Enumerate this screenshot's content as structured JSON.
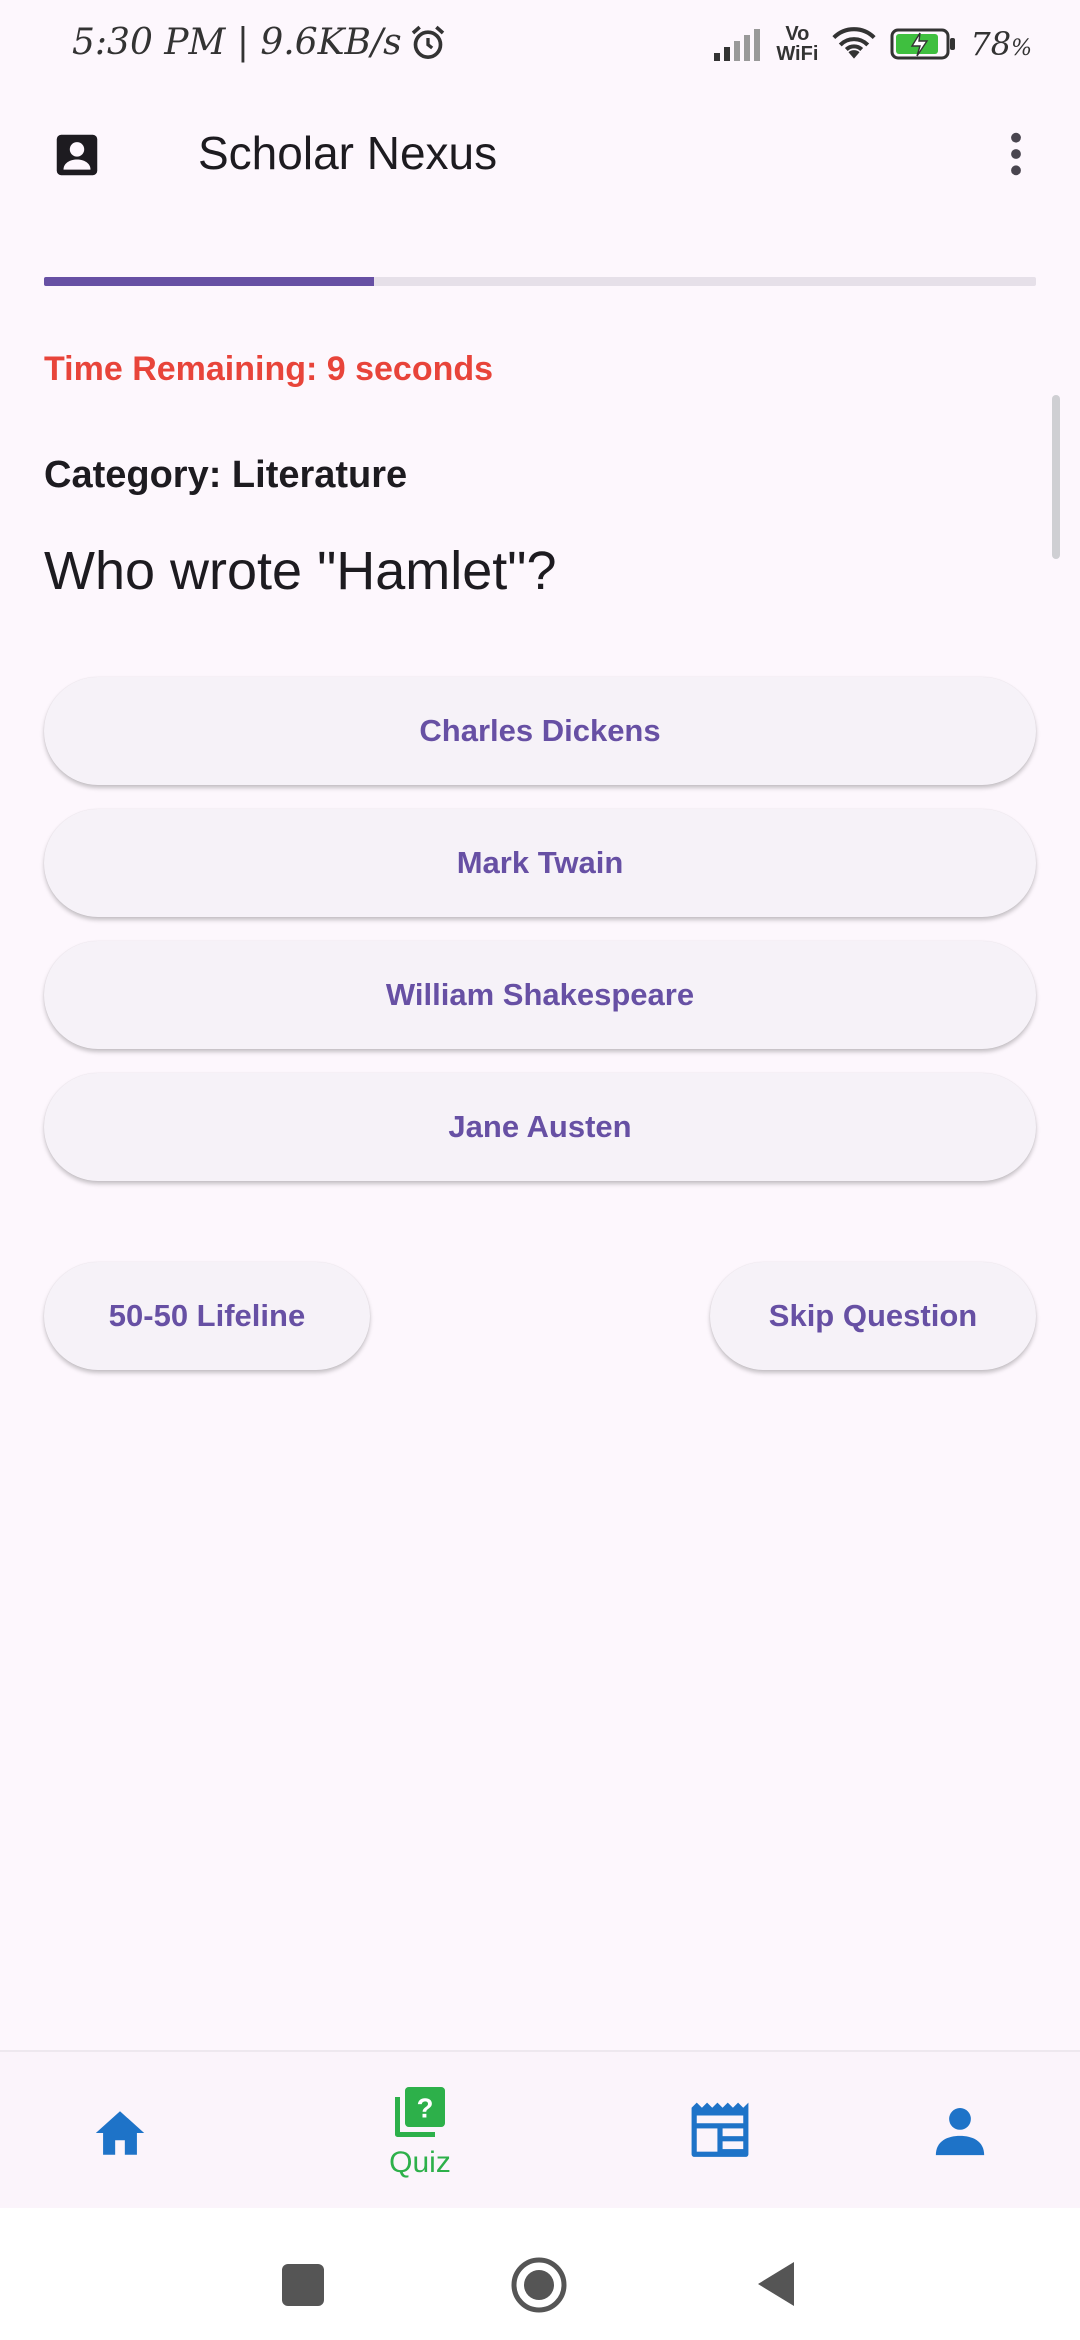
{
  "status_bar": {
    "time_speed": "5:30 PM | 9.6KB/s",
    "vo": "Vo",
    "wifi_label": "WiFi",
    "battery": "78",
    "battery_unit": "%"
  },
  "app_bar": {
    "title": "Scholar Nexus"
  },
  "quiz": {
    "progress": 0.333,
    "timer_text": "Time Remaining: 9 seconds",
    "category_text": "Category: Literature",
    "question": "Who wrote \"Hamlet\"?",
    "answers": [
      "Charles Dickens",
      "Mark Twain",
      "William Shakespeare",
      "Jane Austen"
    ],
    "lifeline_label": "50-50 Lifeline",
    "skip_label": "Skip Question"
  },
  "bottom_nav": {
    "quiz_label": "Quiz",
    "active_color": "#2db04a",
    "icon_color": "#1e73c8"
  },
  "colors": {
    "accent": "#6750a4",
    "timer": "#e8443a",
    "background": "#fdf7fd"
  }
}
